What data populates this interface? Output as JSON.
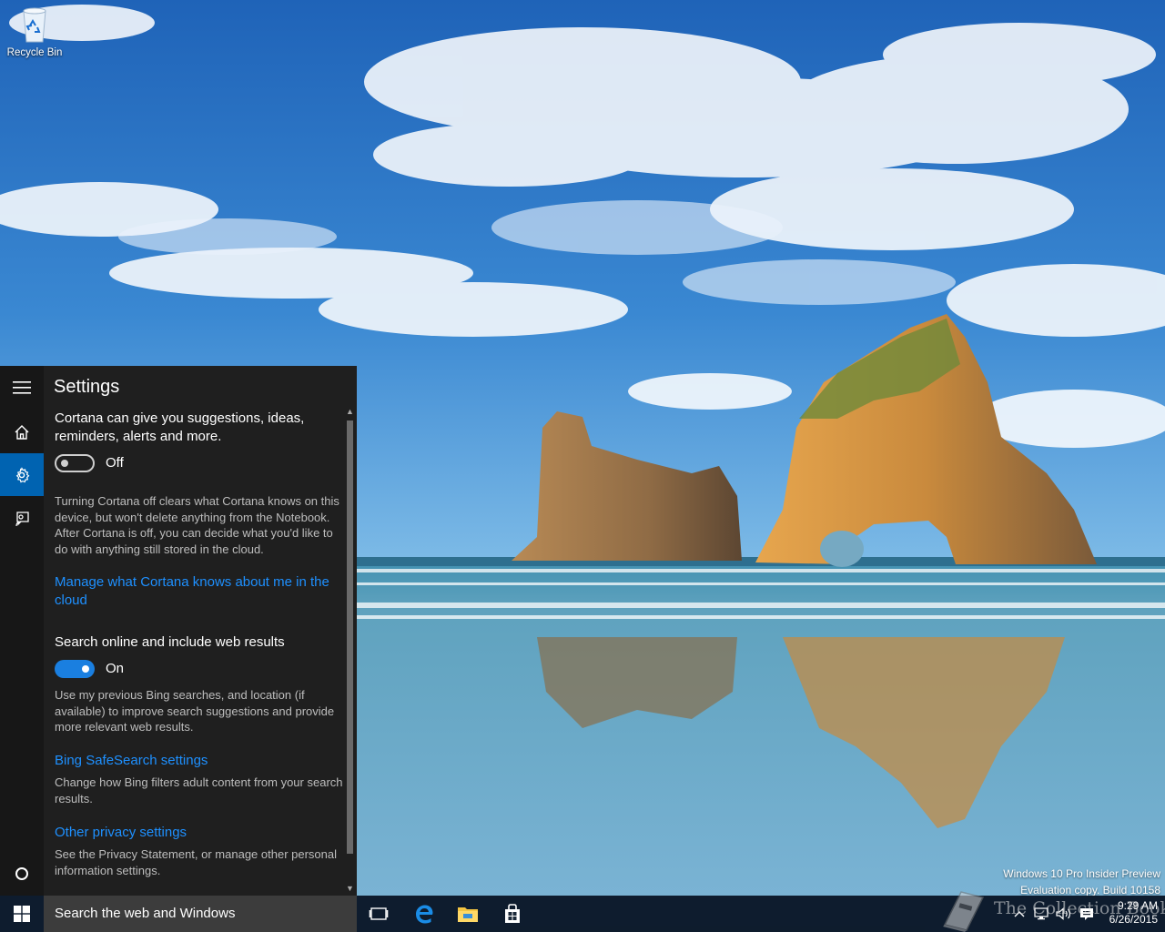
{
  "desktop": {
    "icons": [
      {
        "label": "Recycle Bin",
        "icon": "recycle-bin-icon"
      }
    ],
    "watermark": {
      "line1": "Windows 10 Pro Insider Preview",
      "line2": "Evaluation copy. Build 10158"
    }
  },
  "cortana": {
    "title": "Settings",
    "rail": [
      {
        "icon": "hamburger-menu-icon",
        "active": false
      },
      {
        "icon": "home-icon",
        "active": false
      },
      {
        "icon": "gear-icon",
        "active": true
      },
      {
        "icon": "feedback-icon",
        "active": false
      },
      {
        "icon": "cortana-circle-icon",
        "active": false
      }
    ],
    "suggestions": {
      "heading": "Cortana can give you suggestions, ideas, reminders, alerts and more.",
      "toggle_state": "Off",
      "description": "Turning Cortana off clears what Cortana knows on this device, but won't delete anything from the Notebook. After Cortana is off, you can decide what you'd like to do with anything still stored in the cloud.",
      "link": "Manage what Cortana knows about me in the cloud"
    },
    "web_search": {
      "heading": "Search online and include web results",
      "toggle_state": "On",
      "description": "Use my previous Bing searches, and location (if available) to improve search suggestions and provide more relevant web results."
    },
    "safesearch": {
      "link": "Bing SafeSearch settings",
      "description": "Change how Bing filters adult content from your search results."
    },
    "privacy": {
      "link": "Other privacy settings",
      "description": "See the Privacy Statement, or manage other personal information settings."
    }
  },
  "taskbar": {
    "search_placeholder": "Search the web and Windows",
    "pinned": [
      "task-view-icon",
      "edge-icon",
      "file-explorer-icon",
      "store-icon"
    ],
    "tray": [
      "chevron-up-icon",
      "network-icon",
      "volume-icon",
      "action-center-icon"
    ],
    "clock": {
      "time": "9:29 AM",
      "date": "6/26/2015"
    },
    "brand_watermark": "The Collection Book"
  },
  "colors": {
    "accent": "#0063b1",
    "link": "#1e90ff",
    "toggle_on": "#1a7fe0",
    "panel_bg": "#1f1f1f"
  }
}
